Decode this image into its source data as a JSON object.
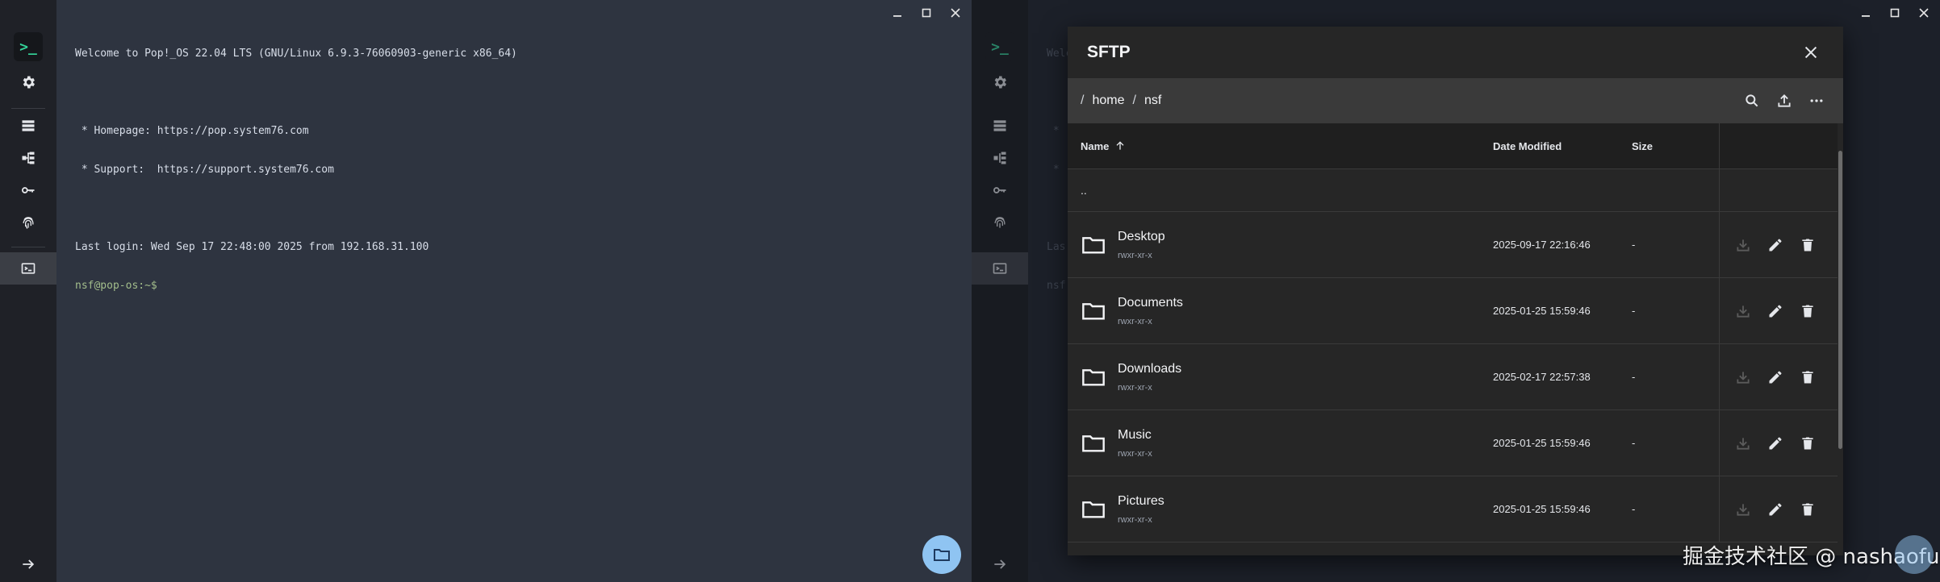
{
  "left_window": {
    "terminal_lines": [
      "Welcome to Pop!_OS 22.04 LTS (GNU/Linux 6.9.3-76060903-generic x86_64)",
      "",
      " * Homepage: https://pop.system76.com",
      " * Support:  https://support.system76.com",
      "",
      "Last login: Wed Sep 17 22:48:00 2025 from 192.168.31.100"
    ],
    "prompt": "nsf@pop-os:~$"
  },
  "right_window": {
    "bg_lines": [
      "Welc",
      "",
      " *",
      " *",
      "",
      "Las",
      "nsf"
    ]
  },
  "sidebar": {
    "logo": ">_",
    "icons": [
      "gear-icon",
      "hosts-list-icon",
      "tree-icon",
      "key-icon",
      "fingerprint-icon",
      "terminal-icon",
      "arrow-right-icon"
    ]
  },
  "sftp": {
    "title": "SFTP",
    "path": {
      "sep": "/",
      "segments": [
        "home",
        "nsf"
      ]
    },
    "columns": {
      "name": "Name",
      "date": "Date Modified",
      "size": "Size"
    },
    "parent_row": "..",
    "rows": [
      {
        "name": "Desktop",
        "perm": "rwxr-xr-x",
        "date": "2025-09-17 22:16:46",
        "size": "-"
      },
      {
        "name": "Documents",
        "perm": "rwxr-xr-x",
        "date": "2025-01-25 15:59:46",
        "size": "-"
      },
      {
        "name": "Downloads",
        "perm": "rwxr-xr-x",
        "date": "2025-02-17 22:57:38",
        "size": "-"
      },
      {
        "name": "Music",
        "perm": "rwxr-xr-x",
        "date": "2025-01-25 15:59:46",
        "size": "-"
      },
      {
        "name": "Pictures",
        "perm": "rwxr-xr-x",
        "date": "2025-01-25 15:59:46",
        "size": "-"
      }
    ]
  },
  "watermark": "掘金技术社区 @ nashaofu",
  "colors": {
    "terminal_bg": "#2e3440",
    "prompt": "#a3be8c",
    "fab": "#8fc4f2",
    "accent_logo": "#34d399"
  }
}
